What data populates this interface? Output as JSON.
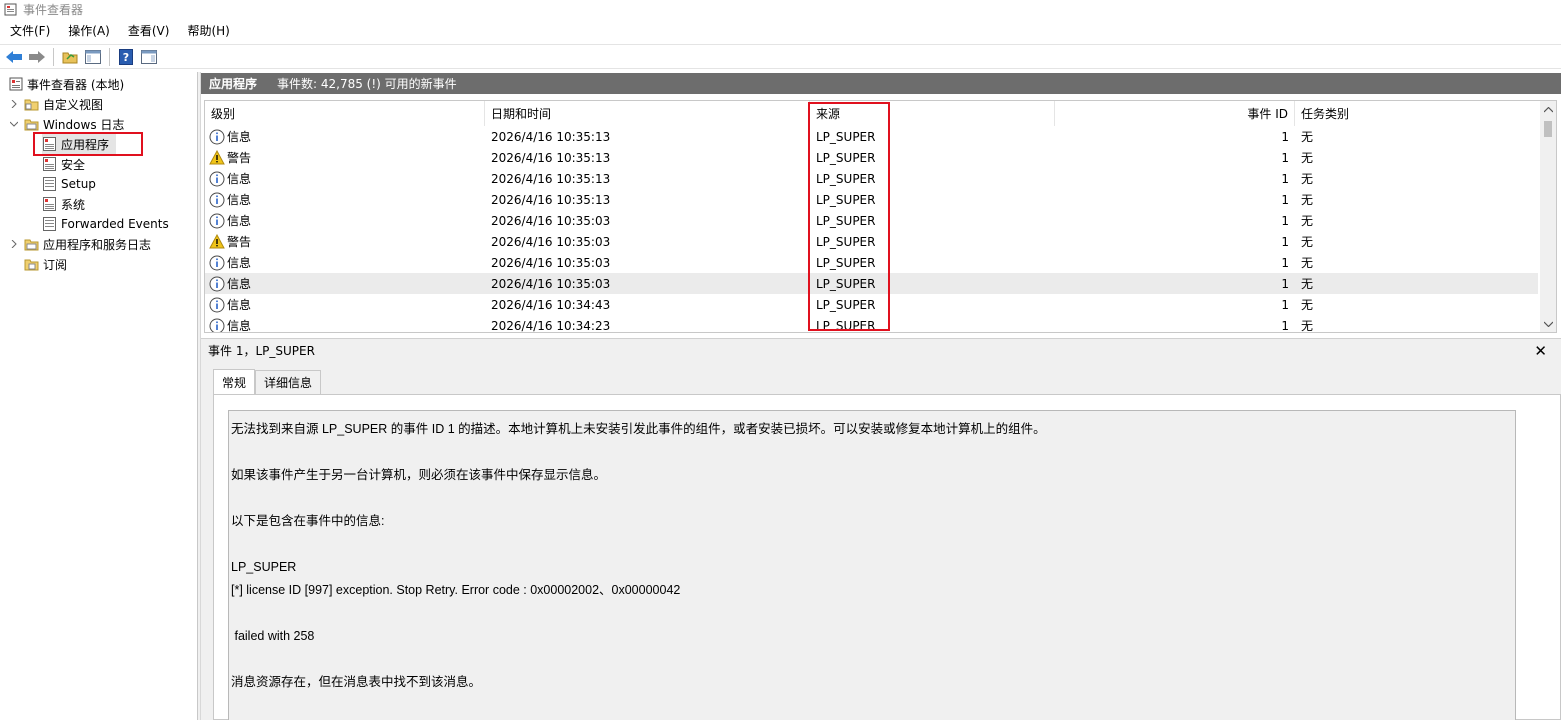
{
  "window": {
    "title": "事件查看器"
  },
  "menu": [
    "文件(F)",
    "操作(A)",
    "查看(V)",
    "帮助(H)"
  ],
  "toolbar": {
    "buttons": [
      "back-arrow-icon",
      "forward-arrow-icon",
      "open-folder-icon",
      "console-tree-icon",
      "help-icon",
      "action-pane-icon"
    ]
  },
  "tree": {
    "root": "事件查看器 (本地)",
    "custom_views": "自定义视图",
    "windows_logs": "Windows 日志",
    "application": "应用程序",
    "security": "安全",
    "setup": "Setup",
    "system": "系统",
    "forwarded": "Forwarded Events",
    "app_service_logs": "应用程序和服务日志",
    "subscriptions": "订阅"
  },
  "header": {
    "title": "应用程序",
    "info": "事件数: 42,785 (!) 可用的新事件"
  },
  "columns": {
    "level": "级别",
    "datetime": "日期和时间",
    "source": "来源",
    "event_id": "事件 ID",
    "task": "任务类别"
  },
  "rows": [
    {
      "level": "信息",
      "icon": "info",
      "datetime": "2026/4/16 10:35:13",
      "source": "LP_SUPER",
      "event_id": "1",
      "task": "无"
    },
    {
      "level": "警告",
      "icon": "warning",
      "datetime": "2026/4/16 10:35:13",
      "source": "LP_SUPER",
      "event_id": "1",
      "task": "无"
    },
    {
      "level": "信息",
      "icon": "info",
      "datetime": "2026/4/16 10:35:13",
      "source": "LP_SUPER",
      "event_id": "1",
      "task": "无"
    },
    {
      "level": "信息",
      "icon": "info",
      "datetime": "2026/4/16 10:35:13",
      "source": "LP_SUPER",
      "event_id": "1",
      "task": "无"
    },
    {
      "level": "信息",
      "icon": "info",
      "datetime": "2026/4/16 10:35:03",
      "source": "LP_SUPER",
      "event_id": "1",
      "task": "无"
    },
    {
      "level": "警告",
      "icon": "warning",
      "datetime": "2026/4/16 10:35:03",
      "source": "LP_SUPER",
      "event_id": "1",
      "task": "无"
    },
    {
      "level": "信息",
      "icon": "info",
      "datetime": "2026/4/16 10:35:03",
      "source": "LP_SUPER",
      "event_id": "1",
      "task": "无"
    },
    {
      "level": "信息",
      "icon": "info",
      "datetime": "2026/4/16 10:35:03",
      "source": "LP_SUPER",
      "event_id": "1",
      "task": "无"
    },
    {
      "level": "信息",
      "icon": "info",
      "datetime": "2026/4/16 10:34:43",
      "source": "LP_SUPER",
      "event_id": "1",
      "task": "无"
    },
    {
      "level": "信息",
      "icon": "info",
      "datetime": "2026/4/16 10:34:23",
      "source": "LP_SUPER",
      "event_id": "1",
      "task": "无"
    }
  ],
  "detail": {
    "title": "事件 1，LP_SUPER",
    "close": "✕",
    "tab_general": "常规",
    "tab_details": "详细信息",
    "lines": [
      "无法找到来自源 LP_SUPER 的事件 ID 1 的描述。本地计算机上未安装引发此事件的组件，或者安装已损坏。可以安装或修复本地计算机上的组件。",
      "",
      "如果该事件产生于另一台计算机，则必须在该事件中保存显示信息。",
      "",
      "以下是包含在事件中的信息:",
      "",
      "LP_SUPER",
      "[*] license ID [997] exception. Stop Retry. Error code : 0x00002002、0x00000042",
      "",
      " failed with 258",
      "",
      "消息资源存在，但在消息表中找不到该消息。"
    ]
  },
  "colors": {
    "header_strip": "#6d6d6d",
    "highlight": "#e0101e",
    "info_blue": "#2a64c8",
    "warning_yellow": "#f0c419"
  }
}
